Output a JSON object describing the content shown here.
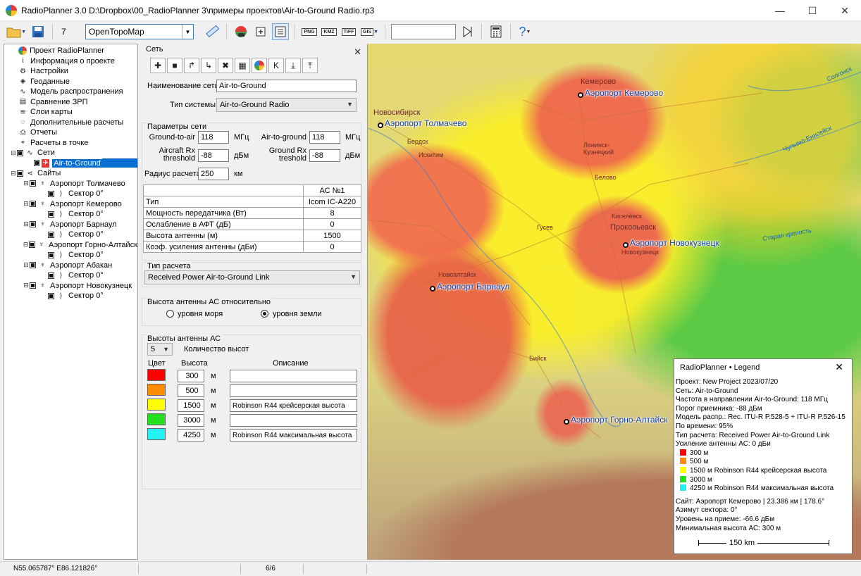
{
  "window": {
    "title": "RadioPlanner 3.0 D:\\Dropbox\\00_RadioPlanner 3\\примеры проектов\\Air-to-Ground Radio.rp3",
    "minimize": "—",
    "maximize": "☐",
    "close": "✕"
  },
  "toolbar": {
    "zoom_level": "7",
    "map_provider": "OpenTopoMap",
    "formats": [
      "PNG",
      "KMZ",
      "TIFF",
      "GIS"
    ],
    "search_value": ""
  },
  "tree": {
    "items": [
      {
        "label": "Проект RadioPlanner",
        "icon": "radioplanner-globe-icon"
      },
      {
        "label": "Информация о проекте",
        "icon": "info-icon"
      },
      {
        "label": "Настройки",
        "icon": "gear-icon"
      },
      {
        "label": "Геоданные",
        "icon": "layers-icon"
      },
      {
        "label": "Модель распространения",
        "icon": "wave-icon"
      },
      {
        "label": "Сравнение ЗРП",
        "icon": "compare-icon"
      },
      {
        "label": "Слои карты",
        "icon": "stack-icon"
      },
      {
        "label": "Дополнительные расчеты",
        "icon": "dotted-circle-icon"
      },
      {
        "label": "Отчеты",
        "icon": "printer-icon"
      },
      {
        "label": "Расчеты в точке",
        "icon": "point-icon"
      }
    ],
    "networks_label": "Сети",
    "network_selected": "Air-to-Ground",
    "sites_label": "Сайты",
    "sites": [
      {
        "name": "Аэропорт Толмачево",
        "sector": "Сектор 0°"
      },
      {
        "name": "Аэропорт Кемерово",
        "sector": "Сектор 0°"
      },
      {
        "name": "Аэропорт Барнаул",
        "sector": "Сектор 0°"
      },
      {
        "name": "Аэропорт Горно-Алтайск",
        "sector": "Сектор 0°"
      },
      {
        "name": "Аэропорт Абакан",
        "sector": "Сектор 0°"
      },
      {
        "name": "Аэропорт Новокузнецк",
        "sector": "Сектор 0°"
      }
    ]
  },
  "panel": {
    "group_title": "Сеть",
    "net_name_label": "Наименование сети",
    "net_name_value": "Air-to-Ground",
    "system_type_label": "Тип системы",
    "system_type_value": "Air-to-Ground Radio",
    "params_title": "Параметры сети",
    "g2a_label": "Ground-to-air",
    "g2a_value": "118",
    "g2a_unit": "МГц",
    "a2g_label": "Air-to-ground",
    "a2g_value": "118",
    "a2g_unit": "МГц",
    "aircraft_rx_label_1": "Aircraft Rx",
    "aircraft_rx_label_2": "threshold",
    "aircraft_rx_value": "-88",
    "aircraft_rx_unit": "дБм",
    "ground_rx_label_1": "Ground Rx",
    "ground_rx_label_2": "treshold",
    "ground_rx_value": "-88",
    "ground_rx_unit": "дБм",
    "radius_label": "Радиус расчета",
    "radius_value": "250",
    "radius_unit": "км",
    "table": {
      "header": "АС №1",
      "rows": [
        {
          "label": "Тип",
          "value": "Icom  IC-A220"
        },
        {
          "label": "Мощность передатчика (Вт)",
          "value": "8"
        },
        {
          "label": "Ослабление в АФТ (дБ)",
          "value": "0"
        },
        {
          "label": "Высота антенны (м)",
          "value": "1500"
        },
        {
          "label": "Коэф. усиления антенны (дБи)",
          "value": "0"
        }
      ]
    },
    "calc_type_title": "Тип расчета",
    "calc_type_value": "Received Power Air-to-Ground Link",
    "antenna_ref_title": "Высота антенны АС относительно",
    "radio_sea": "уровня моря",
    "radio_ground": "уровня земли",
    "heights_title": "Высоты антенны АС",
    "heights_count_value": "5",
    "heights_count_label": "Количество высот",
    "col_color": "Цвет",
    "col_height": "Высота",
    "col_desc": "Описание",
    "heights": [
      {
        "color": "#ff0000",
        "value": "300",
        "unit": "м",
        "desc": ""
      },
      {
        "color": "#ff8c00",
        "value": "500",
        "unit": "м",
        "desc": ""
      },
      {
        "color": "#ffff00",
        "value": "1500",
        "unit": "м",
        "desc": "Robinson R44 крейсерская высота"
      },
      {
        "color": "#22e01e",
        "value": "3000",
        "unit": "м",
        "desc": ""
      },
      {
        "color": "#22f2f2",
        "value": "4250",
        "unit": "м",
        "desc": "Robinson R44 максимальная высота"
      }
    ]
  },
  "map": {
    "airports": [
      {
        "name": "Аэропорт Толмачево"
      },
      {
        "name": "Аэропорт Кемерово"
      },
      {
        "name": "Аэропорт Новокузнецк"
      },
      {
        "name": "Аэропорт Барнаул"
      },
      {
        "name": "Аэропорт Горно-Алтайск"
      }
    ],
    "cities": [
      "Новосибирск",
      "Бердск",
      "Искитим",
      "Кемерово",
      "Ленинск-Кузнецкий",
      "Белово",
      "Киселёвск",
      "Прокопьевск",
      "Новокузнецк",
      "Гусев",
      "Новоалтайск",
      "Бийск"
    ],
    "rivers": [
      "Солгонск",
      "Чулымо-Енисейск",
      "Старая крепость"
    ]
  },
  "legend": {
    "title": "RadioPlanner • Legend",
    "lines": [
      "Проект: New Project 2023/07/20",
      "Сеть: Air-to-Ground",
      "Частота в направлении Air-to-Ground: 118 МГц",
      "Порог приемника: -88 дБм",
      "Модель распр.: Rec. ITU-R P.528-5 + ITU-R P.526-15",
      "По времени: 95%",
      "Тип расчета: Received Power Air-to-Ground Link",
      "Усиление антенны АС: 0 дБи"
    ],
    "entries": [
      {
        "color": "#ff0000",
        "label": "300 м"
      },
      {
        "color": "#ff8c00",
        "label": "500 м"
      },
      {
        "color": "#ffff00",
        "label": "1500 м Robinson R44 крейсерская высота"
      },
      {
        "color": "#22e01e",
        "label": "3000 м"
      },
      {
        "color": "#22f2f2",
        "label": "4250 м Robinson R44 максимальная высота"
      }
    ],
    "footer": [
      "Сайт: Аэропорт Кемерово | 23.386 км | 178.6°",
      "Азимут сектора: 0°",
      "Уровень на приеме: -66.6 дБм",
      "Минимальная высота АС: 300 м"
    ],
    "scale": "150 km"
  },
  "status": {
    "coords": "N55.065787°  E86.121826°",
    "pages": "6/6"
  }
}
